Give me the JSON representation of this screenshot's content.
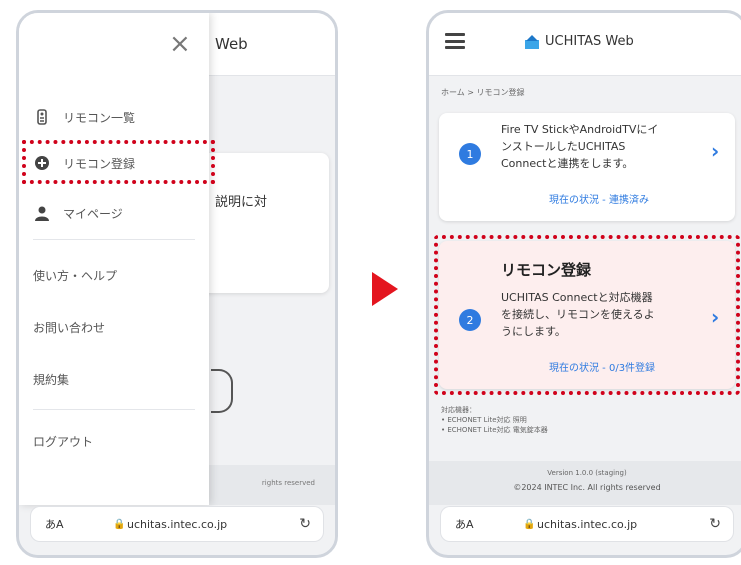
{
  "left_phone": {
    "background": {
      "header_title": "Web",
      "card_text": "説明に対",
      "footer_text": "rights reserved"
    },
    "drawer": {
      "close_symbol": "×",
      "items": [
        {
          "label": "リモコン一覧",
          "icon": "remote-icon"
        },
        {
          "label": "リモコン登録",
          "icon": "add-circle-icon"
        },
        {
          "label": "マイページ",
          "icon": "person-icon"
        }
      ],
      "links": [
        "使い方・ヘルプ",
        "お問い合わせ",
        "規約集",
        "ログアウト"
      ]
    },
    "url_bar": {
      "aa": "あA",
      "lock": "🔒",
      "url": "uchitas.intec.co.jp",
      "reload": "↻"
    }
  },
  "right_phone": {
    "header": {
      "app_name": "UCHITAS Web"
    },
    "breadcrumb": "ホーム > リモコン登録",
    "steps": [
      {
        "number": "1",
        "lines": [
          "Fire TV StickやAndroidTVにイ",
          "ンストールしたUCHITAS",
          "Connectと連携をします。"
        ],
        "status": "現在の状況 - 連携済み",
        "chevron": "›"
      },
      {
        "number": "2",
        "title": "リモコン登録",
        "lines": [
          "UCHITAS Connectと対応機器",
          "を接続し、リモコンを使えるよ",
          "うにします。"
        ],
        "status": "現在の状況 - 0/3件登録",
        "chevron": "›"
      }
    ],
    "supported_devices": [
      "対応機器：",
      "• ECHONET Lite対応 照明",
      "• ECHONET Lite対応 電気錠本器"
    ],
    "footer": {
      "version": "Version 1.0.0 (staging)",
      "copyright": "©2024 INTEC Inc. All rights reserved"
    },
    "url_bar": {
      "aa": "あA",
      "lock": "🔒",
      "url": "uchitas.intec.co.jp",
      "reload": "↻"
    }
  },
  "colors": {
    "accent_blue": "#2f7be0",
    "highlight_red": "#d0021b",
    "arrow_red": "#e4151f",
    "card_pink": "#fdeeee"
  }
}
